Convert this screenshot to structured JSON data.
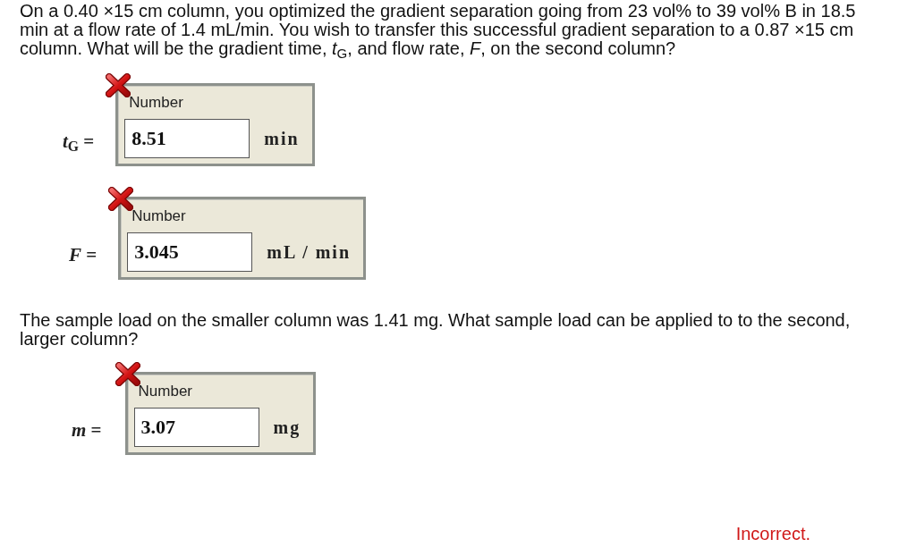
{
  "questions": [
    {
      "prompt": "On a 0.40 ×15 cm column, you optimized the gradient separation going from 23 vol% to 39 vol% B in 18.5 min at a flow rate of 1.4 mL/min. You wish to transfer this successful gradient separation to a 0.87 ×15 cm column. What will be the gradient time, *t*$_{G}$, and flow rate, *F*, on the second column?",
      "answers": [
        {
          "variable": "*t*$_{G}$ =",
          "field_label": "Number",
          "value": "8.51",
          "unit": "min",
          "correct": false
        },
        {
          "variable": "*F* =",
          "field_label": "Number",
          "value": "3.045",
          "unit": "mL / min",
          "correct": false
        }
      ]
    },
    {
      "prompt": "The sample load on the smaller column was 1.41 mg. What sample load can be applied to to the second, larger column?",
      "answers": [
        {
          "variable": "*m* =",
          "field_label": "Number",
          "value": "3.07",
          "unit": "mg",
          "correct": false
        }
      ]
    }
  ],
  "feedback": {
    "text": "Incorrect.",
    "kind": "incorrect"
  }
}
